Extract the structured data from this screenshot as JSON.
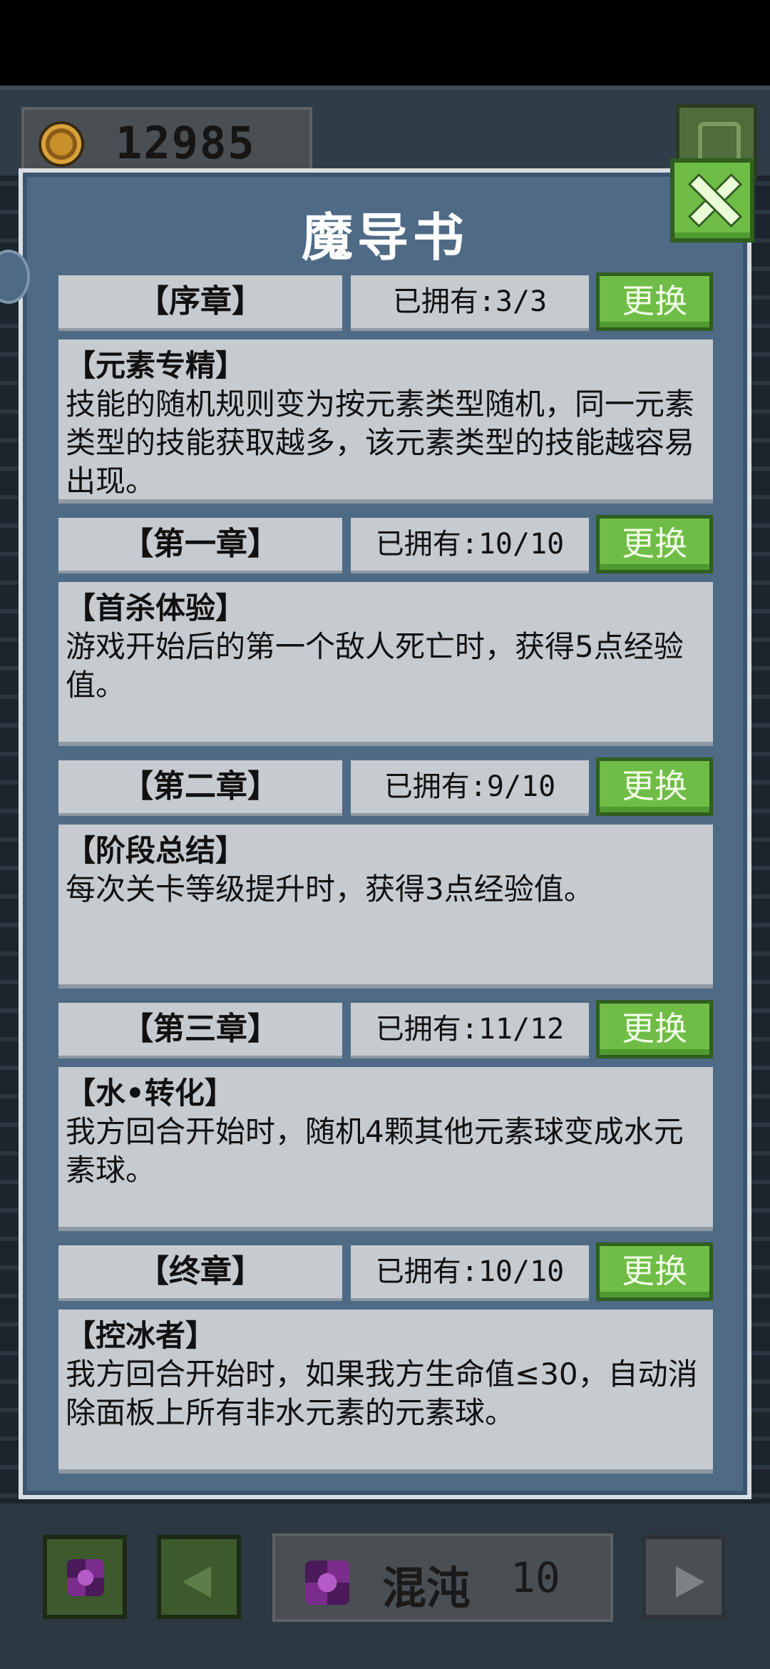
{
  "header": {
    "coins": "12985"
  },
  "panel": {
    "title": "魔导书"
  },
  "chapters": [
    {
      "name": "【序章】",
      "owned": "已拥有:3/3",
      "swap": "更换",
      "skill": "【元素专精】",
      "text": "技能的随机规则变为按元素类型随机，同一元素类型的技能获取越多，该元素类型的技能越容易出现。"
    },
    {
      "name": "【第一章】",
      "owned": "已拥有:10/10",
      "swap": "更换",
      "skill": "【首杀体验】",
      "text": "游戏开始后的第一个敌人死亡时，获得5点经验值。"
    },
    {
      "name": "【第二章】",
      "owned": "已拥有:9/10",
      "swap": "更换",
      "skill": "【阶段总结】",
      "text": "每次关卡等级提升时，获得3点经验值。"
    },
    {
      "name": "【第三章】",
      "owned": "已拥有:11/12",
      "swap": "更换",
      "skill": "【水•转化】",
      "text": "我方回合开始时，随机4颗其他元素球变成水元素球。"
    },
    {
      "name": "【终章】",
      "owned": "已拥有:10/10",
      "swap": "更换",
      "skill": "【控冰者】",
      "text": "我方回合开始时，如果我方生命值≤30，自动消除面板上所有非水元素的元素球。"
    }
  ],
  "footer": {
    "mode_name": "混沌",
    "mode_level": "10"
  },
  "colors": {
    "accent_green": "#6fbd46",
    "panel_blue": "#4e6a85",
    "card_gray": "#c6cbd0"
  }
}
